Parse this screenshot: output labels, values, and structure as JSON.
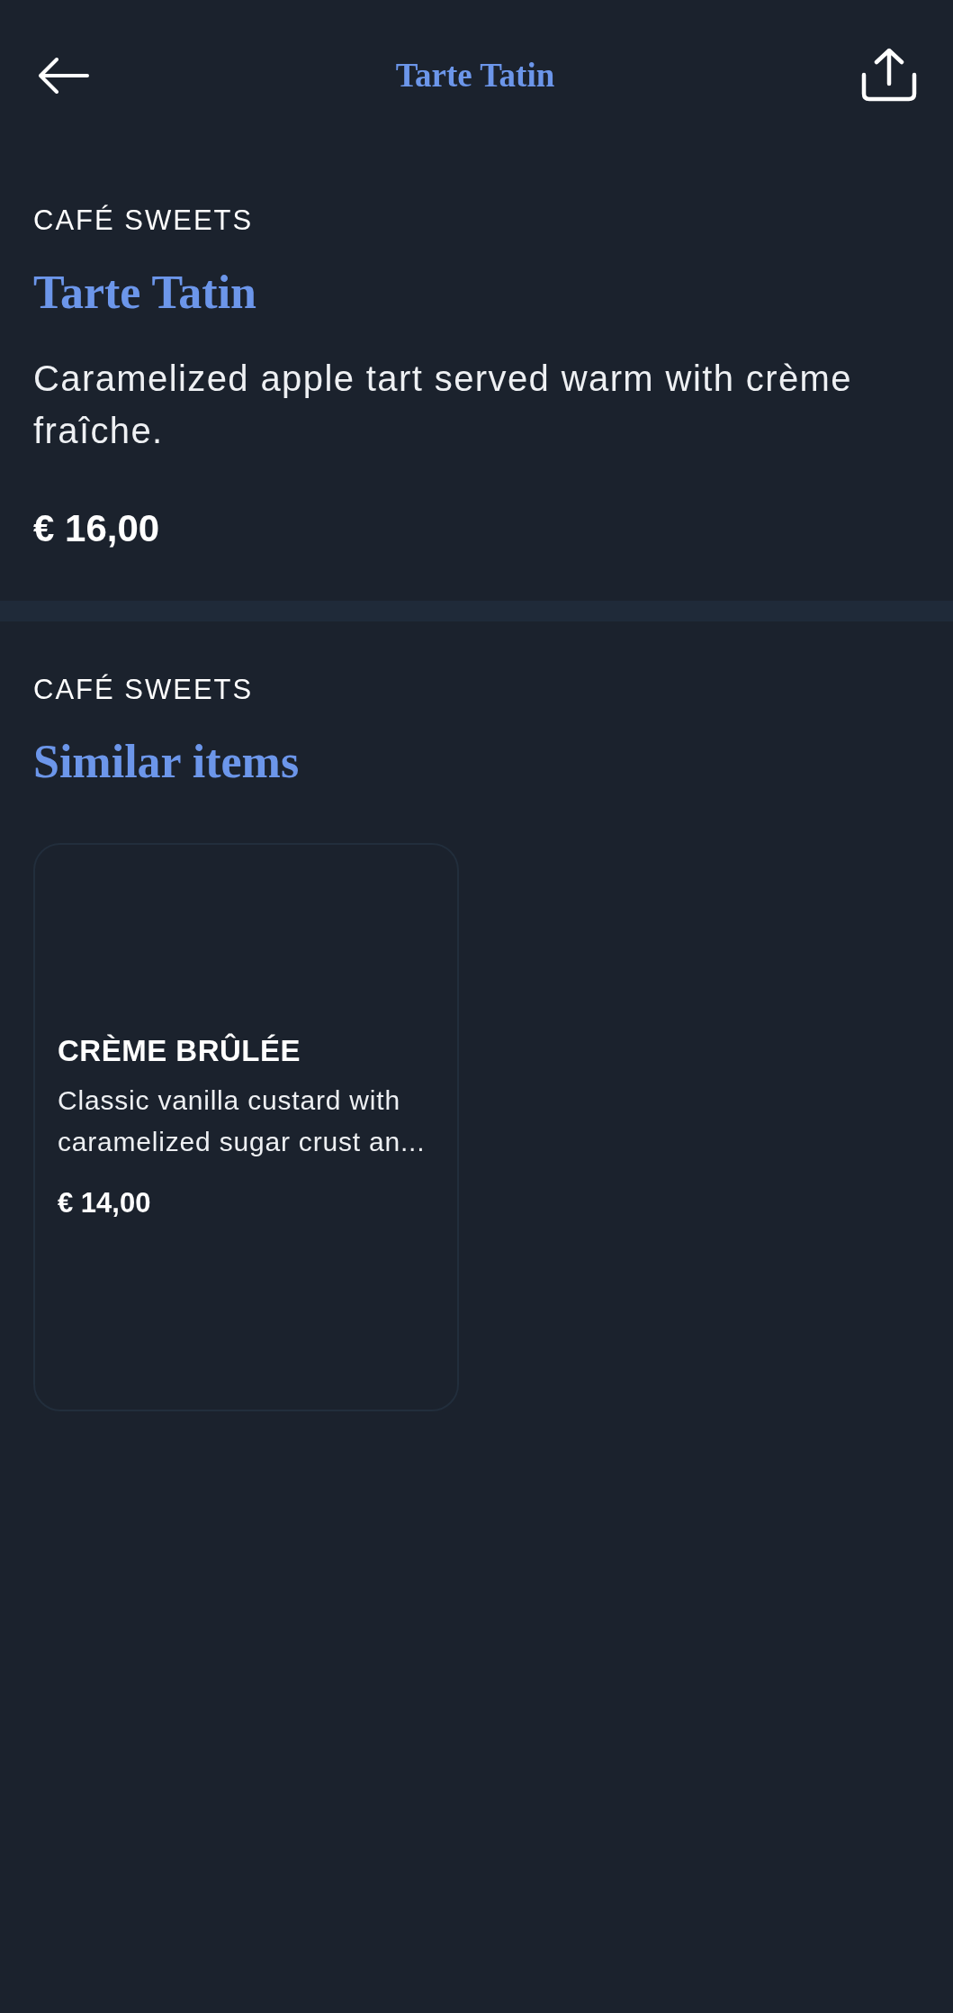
{
  "header": {
    "title": "Tarte Tatin"
  },
  "item": {
    "category": "CAFÉ SWEETS",
    "name": "Tarte Tatin",
    "description": "Caramelized apple tart served warm with crème fraîche.",
    "price": "€ 16,00"
  },
  "similar": {
    "category": "CAFÉ SWEETS",
    "title": "Similar items",
    "items": [
      {
        "name": "CRÈME BRÛLÉE",
        "description": "Classic vanilla custard with caramelized sugar crust an...",
        "price": "€ 14,00"
      }
    ]
  }
}
